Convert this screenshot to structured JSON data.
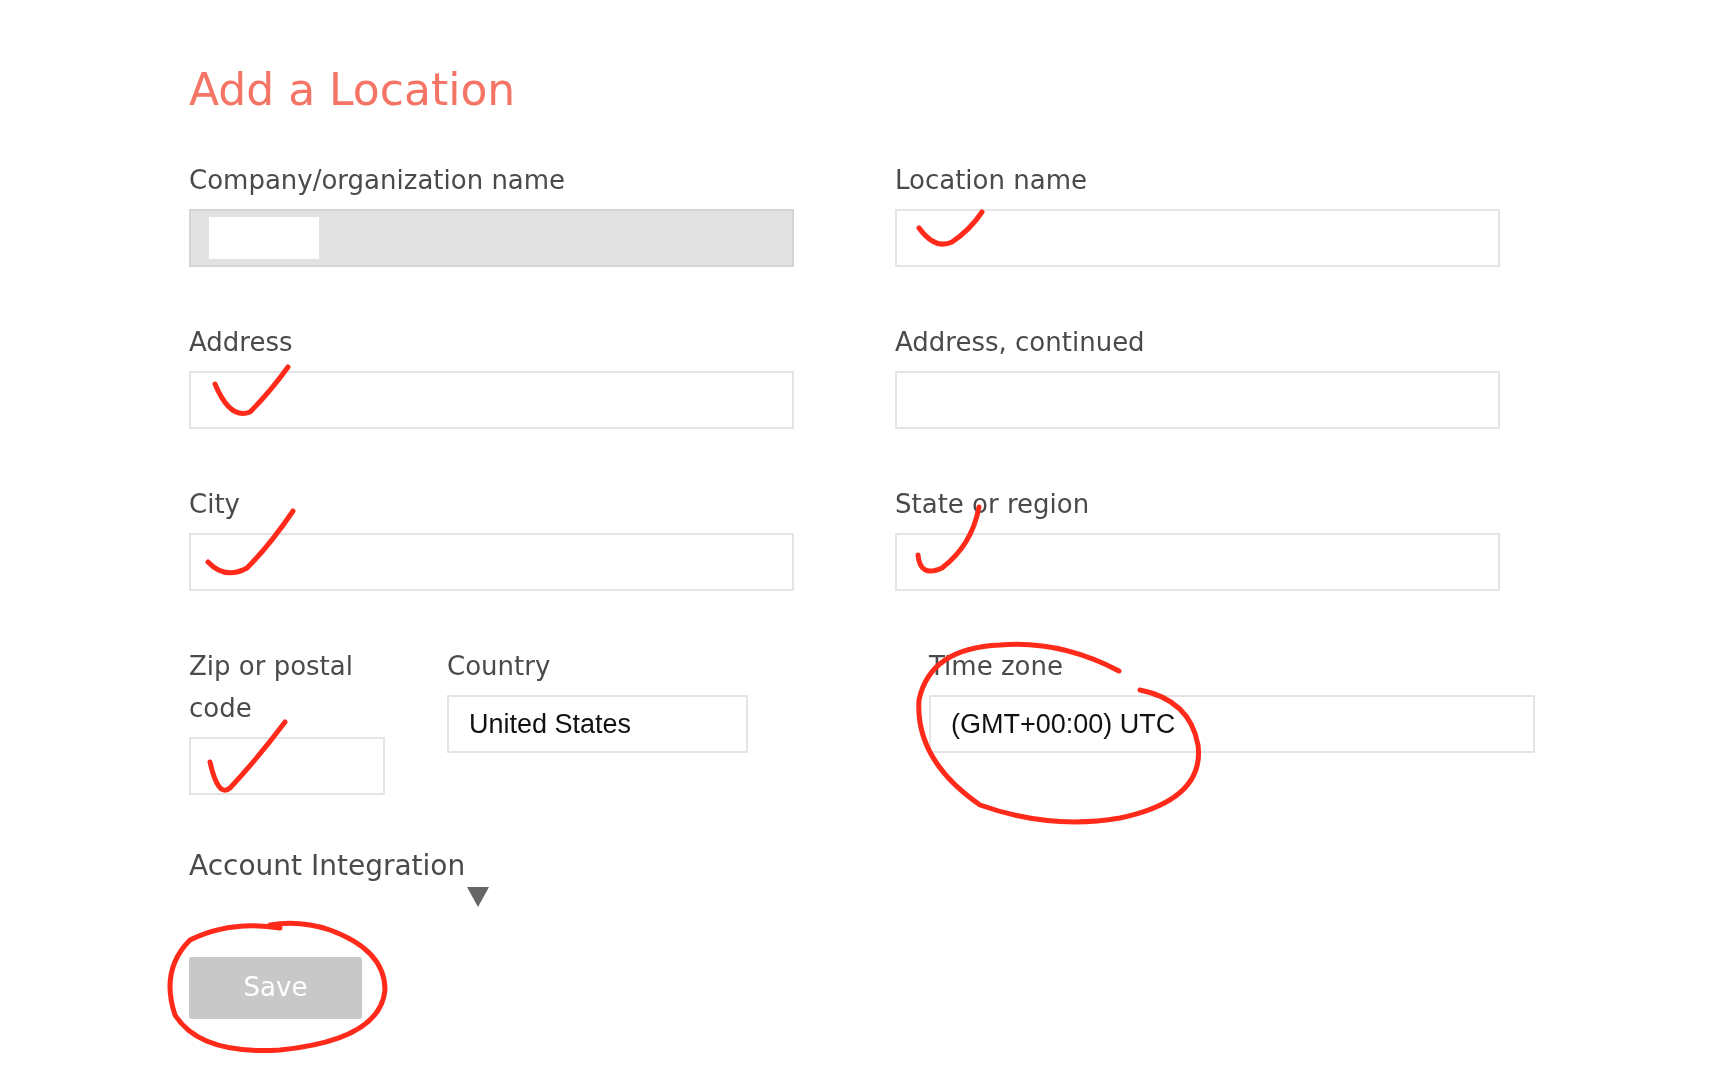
{
  "title": "Add a Location",
  "fields": [
    {
      "label": "Company/organization name",
      "disabled": true,
      "redacted": true
    },
    {
      "label": "Location name",
      "disabled": false,
      "redacted": false
    },
    {
      "label": "Address",
      "disabled": false,
      "redacted": false
    },
    {
      "label": "Address, continued",
      "disabled": false,
      "redacted": false
    },
    {
      "label": "City",
      "disabled": false,
      "redacted": false
    },
    {
      "label": "State or region",
      "disabled": false,
      "redacted": false
    },
    {
      "label": "Zip or postal code",
      "disabled": false,
      "redacted": false
    },
    {
      "label": "Country",
      "value": "United States",
      "disabled": false,
      "redacted": false
    },
    {
      "label": "Time zone",
      "value": "(GMT+00:00) UTC",
      "disabled": false,
      "redacted": false
    }
  ],
  "section": {
    "title": "Account Integration",
    "expanded": false
  },
  "save_button": {
    "label": "Save",
    "disabled": true
  }
}
